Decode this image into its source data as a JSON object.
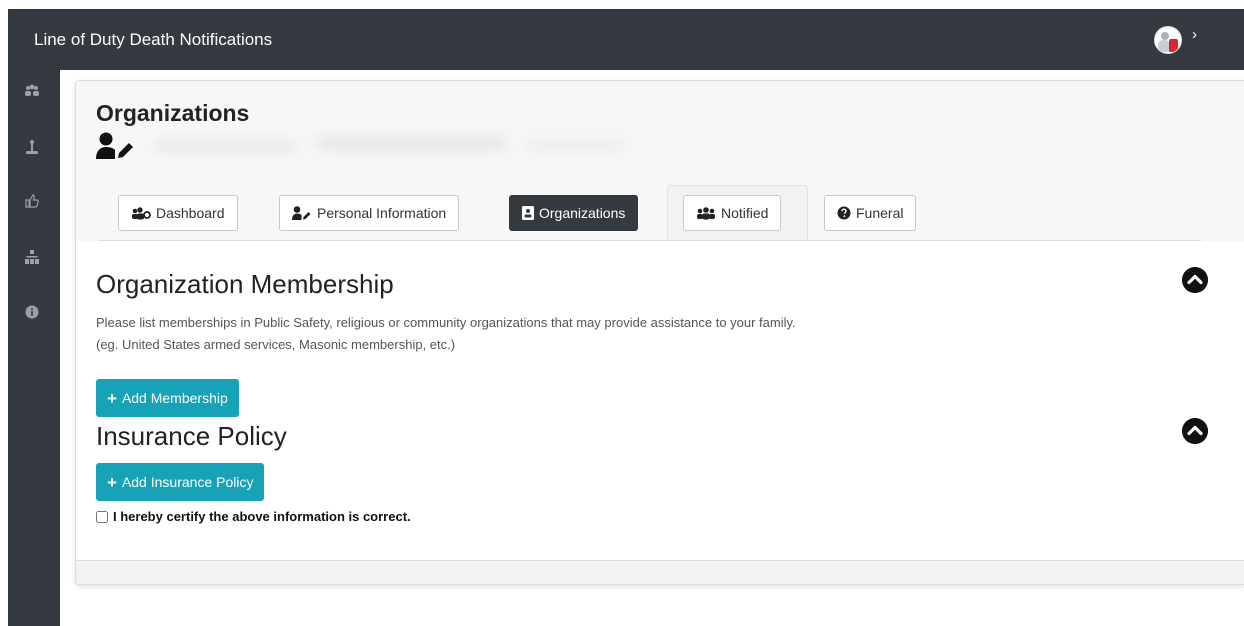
{
  "app": {
    "title": "Line of Duty Death Notifications"
  },
  "sidebar": {
    "items": [
      {
        "icon": "users-cog-icon"
      },
      {
        "icon": "memorial-icon"
      },
      {
        "icon": "thumbs-up-icon"
      },
      {
        "icon": "sitemap-icon"
      },
      {
        "icon": "info-icon"
      }
    ]
  },
  "header": {
    "title": "Organizations"
  },
  "tabs": [
    {
      "label": "Dashboard",
      "icon": "users-cog-icon",
      "active": false
    },
    {
      "label": "Personal Information",
      "icon": "user-edit-icon",
      "active": false
    },
    {
      "label": "Organizations",
      "icon": "id-card-icon",
      "active": true
    },
    {
      "label": "Notified",
      "icon": "users-icon",
      "active": false
    },
    {
      "label": "Funeral",
      "icon": "question-circle-icon",
      "active": false
    }
  ],
  "membership": {
    "title": "Organization Membership",
    "description_line1": "Please list memberships in Public Safety, religious or community organizations that may provide assistance to your family.",
    "description_line2": "(eg. United States armed services, Masonic membership, etc.)",
    "add_label": "Add Membership"
  },
  "insurance": {
    "title": "Insurance Policy",
    "add_label": "Add Insurance Policy"
  },
  "certify": {
    "label": "I hereby certify the above information is correct.",
    "checked": false
  },
  "colors": {
    "topbar": "#343a40",
    "accent": "#17a2b8",
    "active_tab": "#343a40"
  }
}
